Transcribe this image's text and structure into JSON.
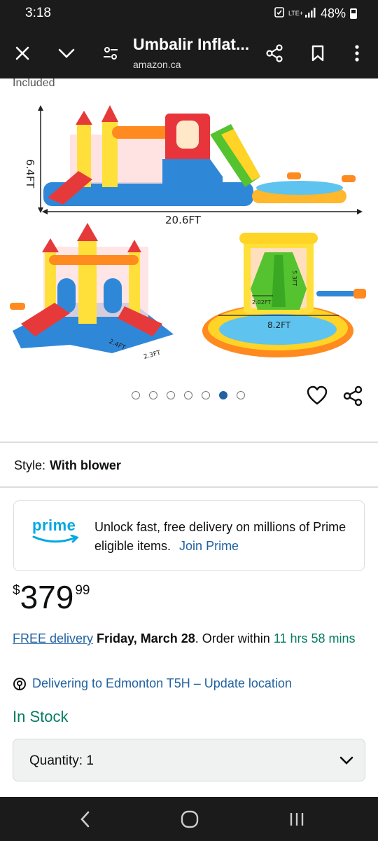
{
  "status_bar": {
    "time": "3:18",
    "network": "LTE+",
    "battery": "48%",
    "icons": [
      "alarm-icon",
      "signal-icon",
      "battery-icon"
    ]
  },
  "browser": {
    "title": "Umbalir Inflat...",
    "url": "amazon.ca",
    "icons": [
      "close-icon",
      "chevron-down-icon",
      "tune-icon",
      "share-icon",
      "bookmark-icon",
      "more-icon"
    ]
  },
  "product": {
    "included_text": "Included",
    "image_labels": {
      "height": "6.4FT",
      "length": "20.6FT",
      "width_a": "2.4FT",
      "width_b": "2.3FT",
      "slide_width": "2.02FT",
      "slide_height": "5.3FT",
      "pool_width": "8.2FT"
    },
    "carousel": {
      "count": 7,
      "active_index": 5
    },
    "style_label": "Style:",
    "style_value": "With blower"
  },
  "prime": {
    "logo_text": "prime",
    "message": "Unlock fast, free delivery on millions of Prime eligible items.",
    "link": "Join Prime"
  },
  "price": {
    "currency": "$",
    "whole": "379",
    "fraction": "99"
  },
  "delivery": {
    "link": "FREE delivery",
    "date": "Friday, March 28",
    "order_within_prefix": ". Order within ",
    "countdown": "11 hrs 58 mins"
  },
  "location": {
    "text": "Delivering to Edmonton T5H – Update location"
  },
  "stock": "In Stock",
  "quantity": {
    "label": "Quantity:",
    "value": "1"
  },
  "colors": {
    "link": "#2162a1",
    "green": "#067d62",
    "dark_bar": "#1b1b1b"
  }
}
